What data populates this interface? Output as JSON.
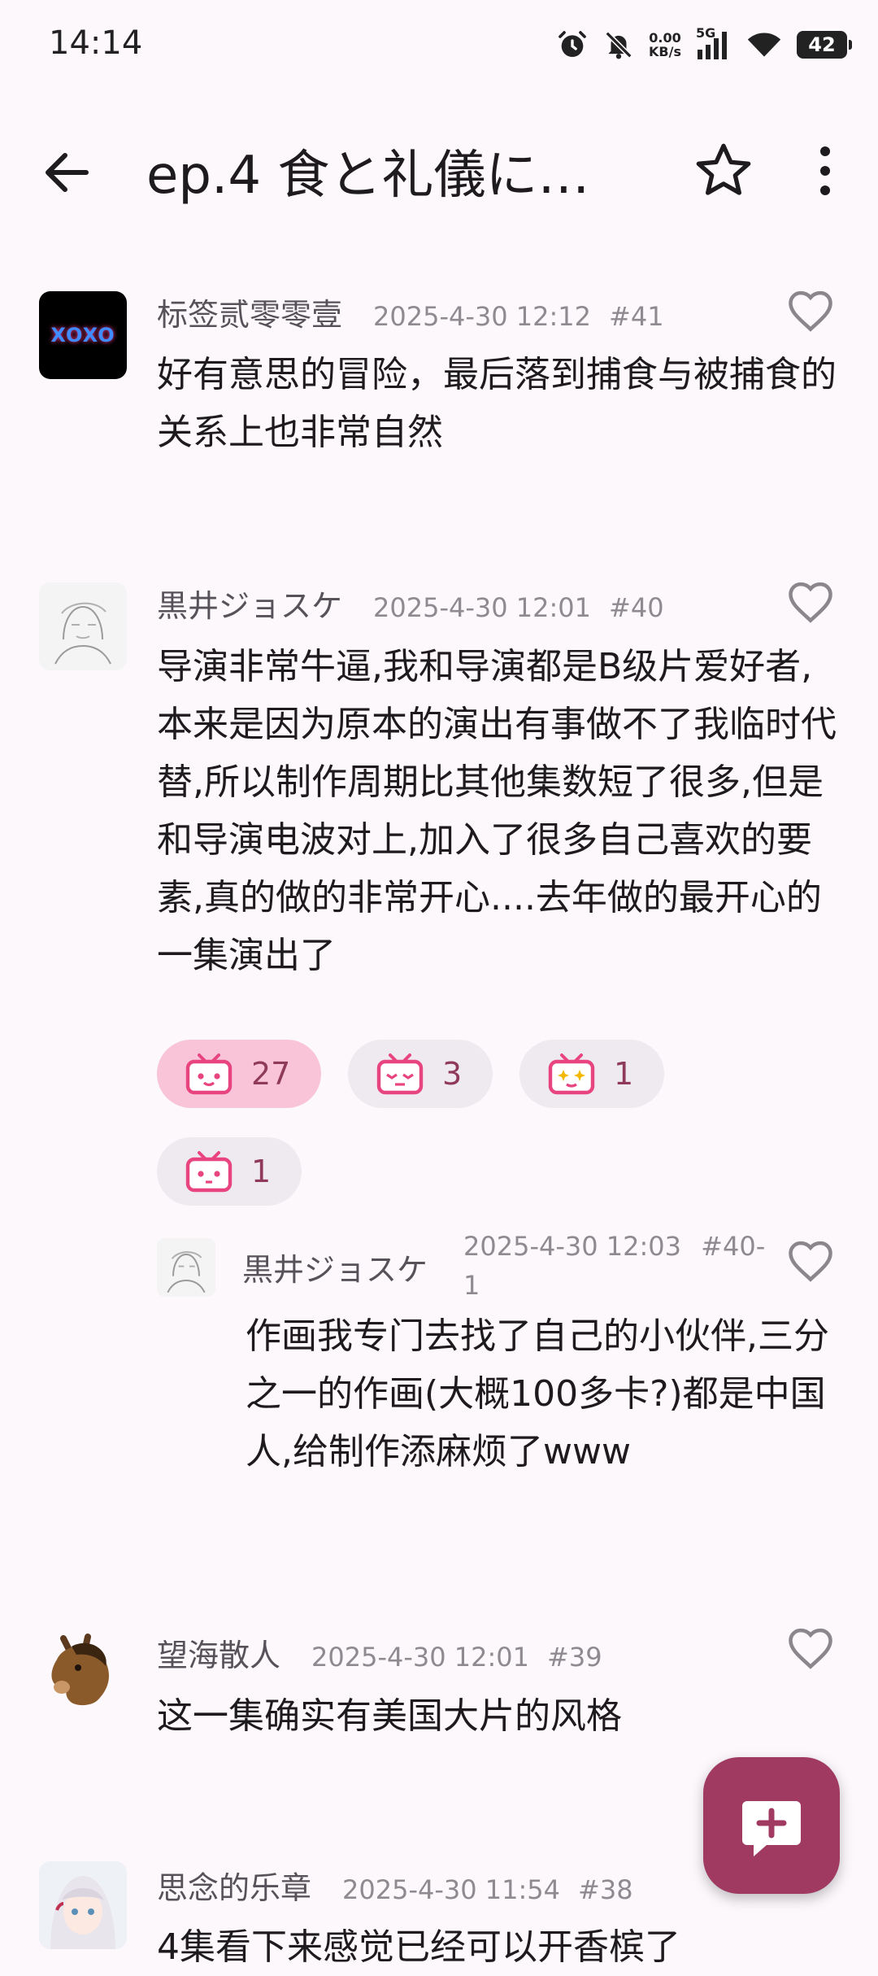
{
  "status_bar": {
    "time": "14:14",
    "net_speed_value": "0.00",
    "net_speed_unit": "KB/s",
    "network_type": "5G",
    "battery": "42",
    "icons": [
      "alarm-icon",
      "bell-off-icon",
      "signal-icon",
      "wifi-icon",
      "battery-icon"
    ]
  },
  "app_bar": {
    "title": "ep.4 食と礼儀に…",
    "icons": [
      "back-arrow-icon",
      "star-outline-icon",
      "more-vert-icon"
    ]
  },
  "comments": [
    {
      "username": "标签贰零零壹",
      "time": "2025-4-30 12:12",
      "floor": "#41",
      "text": "好有意思的冒险，最后落到捕食与被捕食的关系上也非常自然",
      "avatar_text": "XOXO"
    },
    {
      "username": "黒井ジョスケ",
      "time": "2025-4-30 12:01",
      "floor": "#40",
      "text": "导演非常牛逼,我和导演都是B级片爱好者,本来是因为原本的演出有事做不了我临时代替,所以制作周期比其他集数短了很多,但是和导演电波对上,加入了很多自己喜欢的要素,真的做的非常开心....去年做的最开心的一集演出了",
      "reactions": [
        {
          "count": "27",
          "active": true
        },
        {
          "count": "3",
          "active": false
        },
        {
          "count": "1",
          "active": false
        },
        {
          "count": "1",
          "active": false
        }
      ],
      "reply": {
        "username": "黒井ジョスケ",
        "time": "2025-4-30 12:03",
        "floor_line1": "#40-",
        "floor_line2": "1",
        "text": "作画我专门去找了自己的小伙伴,三分之一的作画(大概100多卡?)都是中国人,给制作添麻烦了www"
      }
    },
    {
      "username": "望海散人",
      "time": "2025-4-30 12:01",
      "floor": "#39",
      "text": "这一集确实有美国大片的风格"
    },
    {
      "username": "思念的乐章",
      "time": "2025-4-30 11:54",
      "floor": "#38",
      "text": "4集看下来感觉已经可以开香槟了"
    }
  ],
  "fab": {
    "icon": "add-comment-icon"
  },
  "colors": {
    "background": "#fcf8fc",
    "accent": "#a03a61",
    "reaction_active": "#f9c4d8",
    "reaction_inactive": "#efeaef",
    "meta_text": "#8e8a90"
  }
}
